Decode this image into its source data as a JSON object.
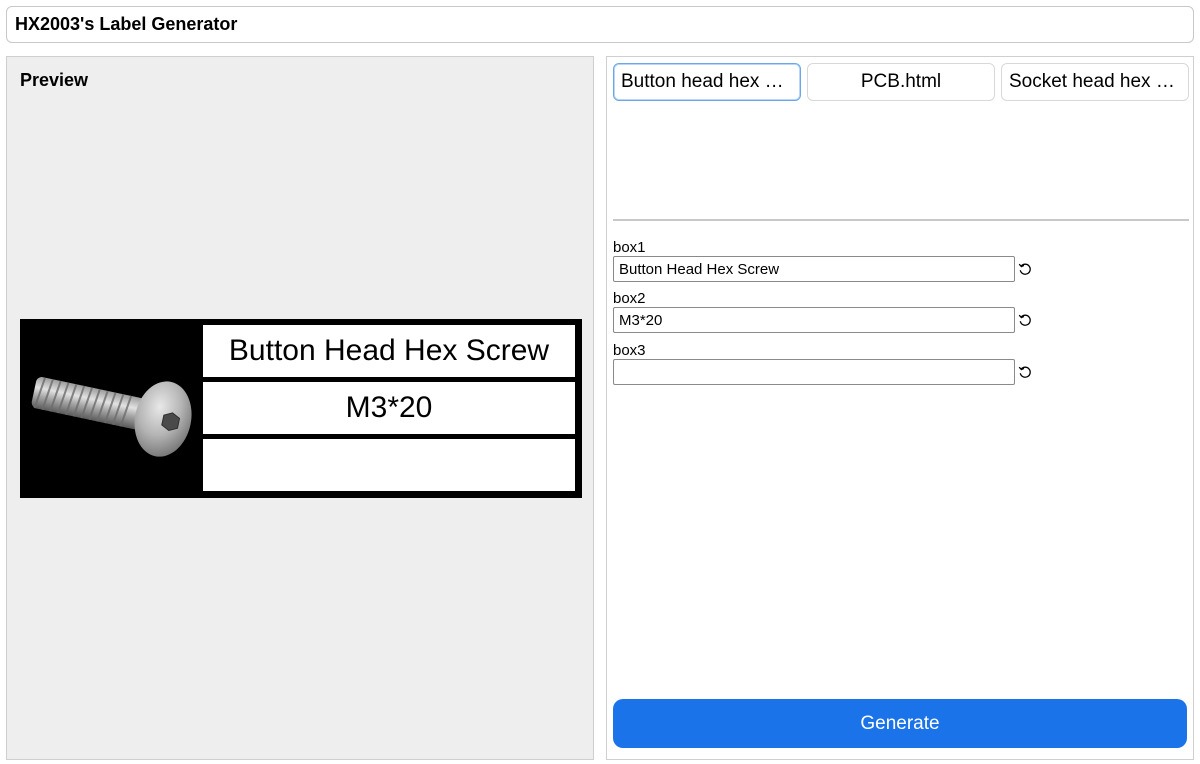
{
  "app": {
    "title": "HX2003's Label Generator"
  },
  "preview": {
    "heading": "Preview",
    "label": {
      "image_icon": "button-head-hex-screw-icon",
      "box1": "Button Head Hex Screw",
      "box2": "M3*20",
      "box3": ""
    }
  },
  "editor": {
    "tabs": [
      {
        "label": "Button head hex …",
        "active": true
      },
      {
        "label": "PCB.html",
        "active": false
      },
      {
        "label": "Socket head hex …",
        "active": false
      }
    ],
    "fields": [
      {
        "label": "box1",
        "value": "Button Head Hex Screw",
        "reset_icon": "reset-icon"
      },
      {
        "label": "box2",
        "value": "M3*20",
        "reset_icon": "reset-icon"
      },
      {
        "label": "box3",
        "value": "",
        "reset_icon": "reset-icon"
      }
    ],
    "generate_label": "Generate"
  },
  "colors": {
    "accent": "#1a73e8",
    "preview_background": "#eeeeee",
    "label_background": "#000000"
  }
}
